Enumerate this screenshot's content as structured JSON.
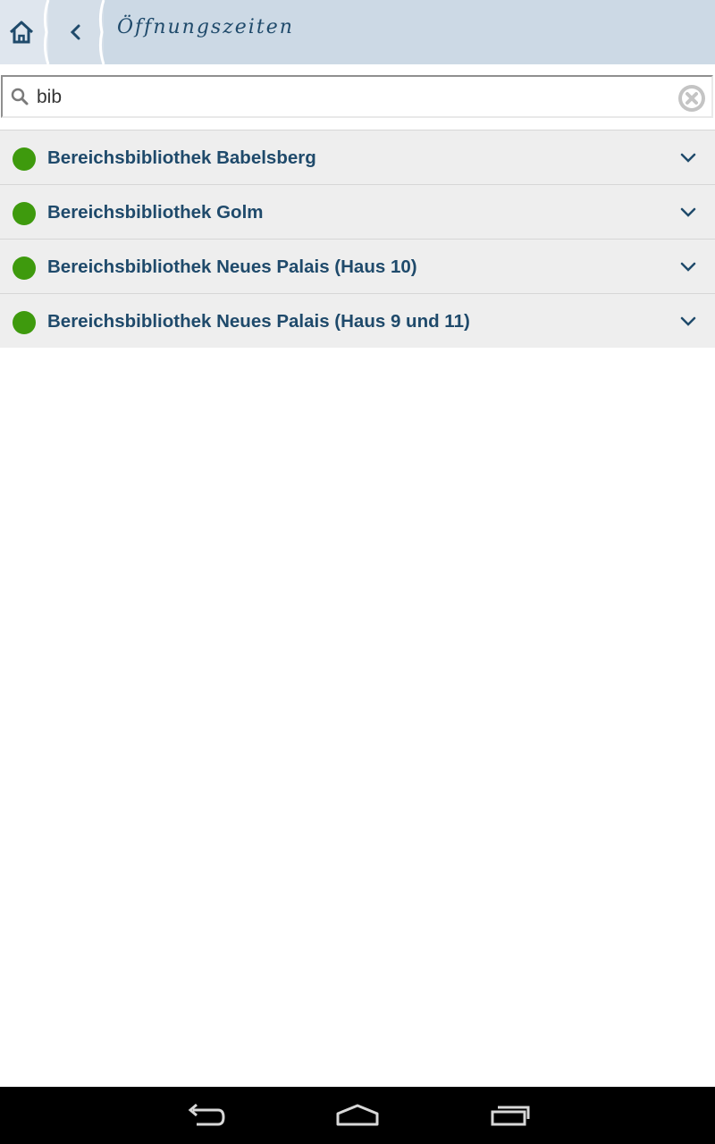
{
  "header": {
    "title": "Öffnungszeiten",
    "home_icon": "home-icon",
    "back_icon": "chevron-left-icon"
  },
  "search": {
    "value": "bib",
    "placeholder": "",
    "search_icon": "search-icon",
    "clear_icon": "clear-circle-icon"
  },
  "libraries": [
    {
      "name": "Bereichsbibliothek Babelsberg",
      "status": "open",
      "status_color": "#3e9a0d"
    },
    {
      "name": "Bereichsbibliothek Golm",
      "status": "open",
      "status_color": "#3e9a0d"
    },
    {
      "name": "Bereichsbibliothek Neues Palais (Haus 10)",
      "status": "open",
      "status_color": "#3e9a0d"
    },
    {
      "name": "Bereichsbibliothek Neues Palais (Haus 9 und 11)",
      "status": "open",
      "status_color": "#3e9a0d"
    }
  ],
  "colors": {
    "header_bg": "#ccd9e5",
    "accent": "#1f4a6b",
    "list_bg": "#eeeeee",
    "open_status": "#3e9a0d"
  },
  "navbar": {
    "back_icon": "nav-back-icon",
    "home_icon": "nav-home-icon",
    "recents_icon": "nav-recents-icon"
  }
}
